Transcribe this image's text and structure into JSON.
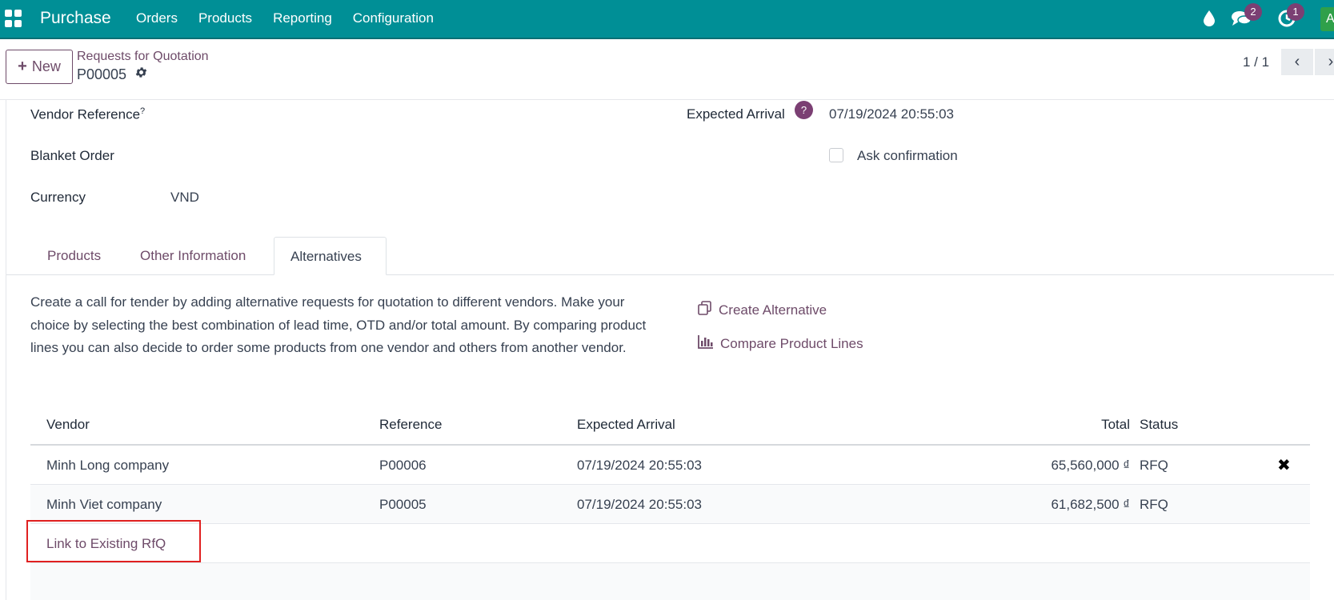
{
  "navbar": {
    "app_name": "Purchase",
    "menu": [
      "Orders",
      "Products",
      "Reporting",
      "Configuration"
    ],
    "messages_badge": "2",
    "activities_badge": "1",
    "avatar_letter": "A",
    "color": "#008f96"
  },
  "control": {
    "new_label": "New",
    "breadcrumb": "Requests for Quotation",
    "record": "P00005",
    "pager": "1 / 1"
  },
  "fields": {
    "vendor_reference": "Vendor Reference",
    "vendor_reference_help": "?",
    "blanket_order": "Blanket Order",
    "currency_label": "Currency",
    "currency_value": "VND",
    "expected_arrival_label": "Expected Arrival",
    "expected_arrival_help": "?",
    "expected_arrival_value": "07/19/2024 20:55:03",
    "ask_confirmation": "Ask confirmation"
  },
  "tabs": [
    "Products",
    "Other Information",
    "Alternatives"
  ],
  "alternatives": {
    "description": "Create a call for tender by adding alternative requests for quotation to different vendors. Make your choice by selecting the best combination of lead time, OTD and/or total amount. By comparing product lines you can also decide to order some products from one vendor and others from another vendor.",
    "create_alternative": "Create Alternative",
    "compare_lines": "Compare Product Lines"
  },
  "table": {
    "headers": [
      "Vendor",
      "Reference",
      "Expected Arrival",
      "Total",
      "Status"
    ],
    "rows": [
      {
        "vendor": "Minh Long company",
        "reference": "P00006",
        "arrival": "07/19/2024 20:55:03",
        "total": "65,560,000 ₫",
        "status": "RFQ"
      },
      {
        "vendor": "Minh Viet company",
        "reference": "P00005",
        "arrival": "07/19/2024 20:55:03",
        "total": "61,682,500 ₫",
        "status": "RFQ"
      }
    ],
    "link_existing": "Link to Existing RfQ"
  }
}
